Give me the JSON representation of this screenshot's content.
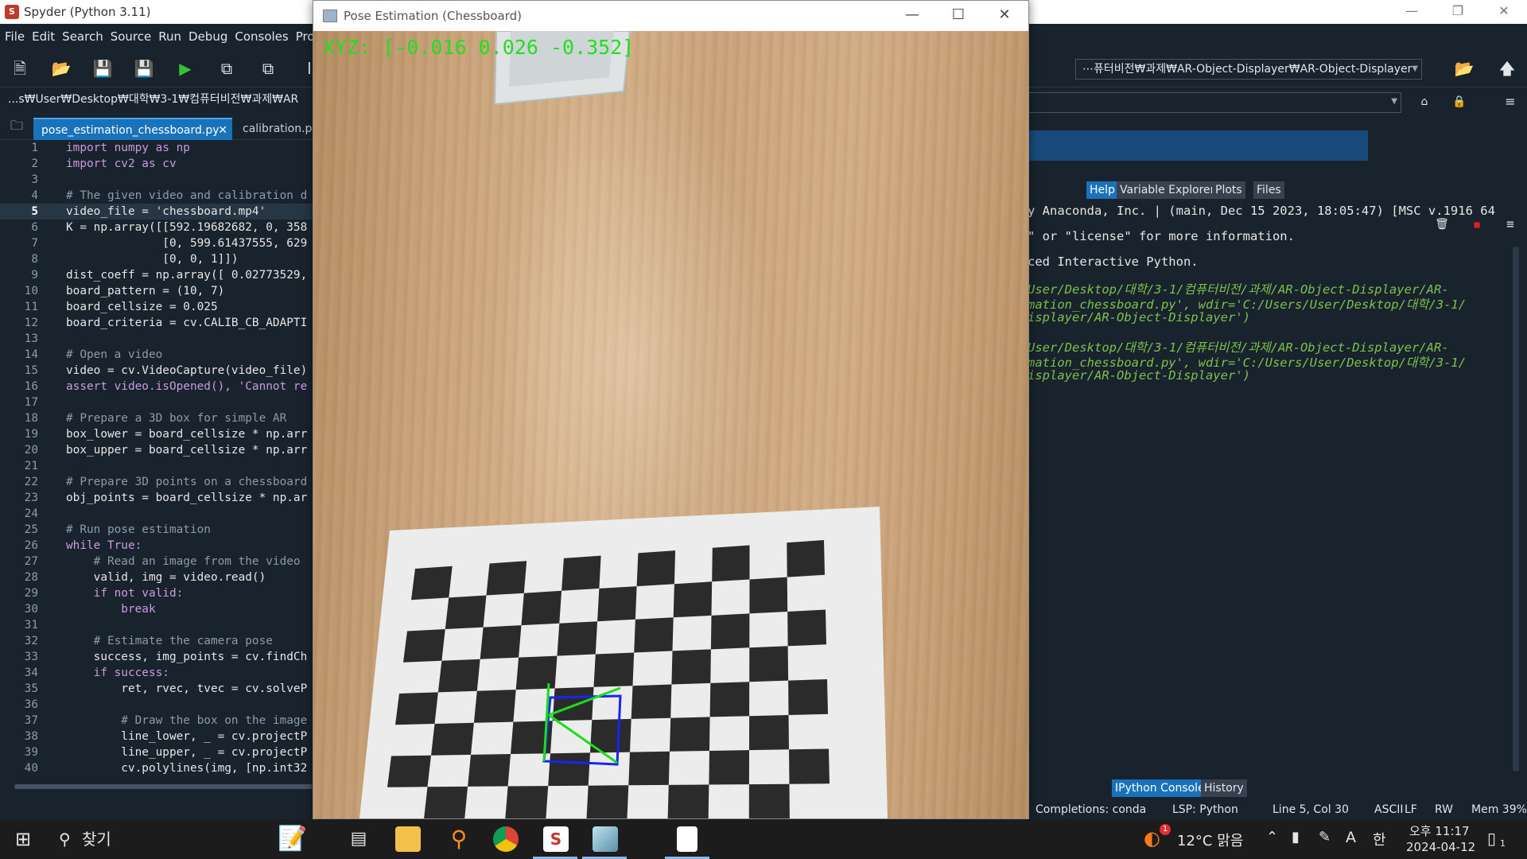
{
  "spyder": {
    "title": "Spyder (Python 3.11)",
    "menu": [
      "File",
      "Edit",
      "Search",
      "Source",
      "Run",
      "Debug",
      "Consoles",
      "Projects"
    ],
    "working_dir": "⋯퓨터비전₩과제₩AR-Object-Displayer₩AR-Object-Displayer",
    "editor_path": "...s₩User₩Desktop₩대학₩3-1₩컴퓨터비전₩과제₩AR",
    "tabs": [
      {
        "label": "pose_estimation_chessboard.py",
        "active": true
      },
      {
        "label": "calibration.py",
        "active": false
      }
    ],
    "code_lines": [
      {
        "n": "1",
        "t": "import numpy as np"
      },
      {
        "n": "2",
        "t": "import cv2 as cv"
      },
      {
        "n": "3",
        "t": ""
      },
      {
        "n": "4",
        "t": "# The given video and calibration d"
      },
      {
        "n": "5",
        "t": "video_file = 'chessboard.mp4'"
      },
      {
        "n": "6",
        "t": "K = np.array([[592.19682682, 0, 358"
      },
      {
        "n": "7",
        "t": "              [0, 599.61437555, 629"
      },
      {
        "n": "8",
        "t": "              [0, 0, 1]])"
      },
      {
        "n": "9",
        "t": "dist_coeff = np.array([ 0.02773529,"
      },
      {
        "n": "10",
        "t": "board_pattern = (10, 7)"
      },
      {
        "n": "11",
        "t": "board_cellsize = 0.025"
      },
      {
        "n": "12",
        "t": "board_criteria = cv.CALIB_CB_ADAPTI"
      },
      {
        "n": "13",
        "t": ""
      },
      {
        "n": "14",
        "t": "# Open a video"
      },
      {
        "n": "15",
        "t": "video = cv.VideoCapture(video_file)"
      },
      {
        "n": "16",
        "t": "assert video.isOpened(), 'Cannot re"
      },
      {
        "n": "17",
        "t": ""
      },
      {
        "n": "18",
        "t": "# Prepare a 3D box for simple AR"
      },
      {
        "n": "19",
        "t": "box_lower = board_cellsize * np.arr"
      },
      {
        "n": "20",
        "t": "box_upper = board_cellsize * np.arr"
      },
      {
        "n": "21",
        "t": ""
      },
      {
        "n": "22",
        "t": "# Prepare 3D points on a chessboard"
      },
      {
        "n": "23",
        "t": "obj_points = board_cellsize * np.ar"
      },
      {
        "n": "24",
        "t": ""
      },
      {
        "n": "25",
        "t": "# Run pose estimation"
      },
      {
        "n": "26",
        "t": "while True:"
      },
      {
        "n": "27",
        "t": "    # Read an image from the video"
      },
      {
        "n": "28",
        "t": "    valid, img = video.read()"
      },
      {
        "n": "29",
        "t": "    if not valid:"
      },
      {
        "n": "30",
        "t": "        break"
      },
      {
        "n": "31",
        "t": ""
      },
      {
        "n": "32",
        "t": "    # Estimate the camera pose"
      },
      {
        "n": "33",
        "t": "    success, img_points = cv.findCh"
      },
      {
        "n": "34",
        "t": "    if success:"
      },
      {
        "n": "35",
        "t": "        ret, rvec, tvec = cv.solveP"
      },
      {
        "n": "36",
        "t": ""
      },
      {
        "n": "37",
        "t": "        # Draw the box on the image"
      },
      {
        "n": "38",
        "t": "        line_lower, _ = cv.projectP"
      },
      {
        "n": "39",
        "t": "        line_upper, _ = cv.projectP"
      },
      {
        "n": "40",
        "t": "        cv.polylines(img, [np.int32"
      }
    ],
    "current_line": "5",
    "pane_tabs_top": [
      "Help",
      "Variable Explorer",
      "Plots",
      "Files"
    ],
    "console_lines": [
      {
        "t": "y Anaconda, Inc. | (main, Dec 15 2023, 18:05:47) [MSC v.1916 64",
        "g": false
      },
      {
        "t": "\" or \"license\" for more information.",
        "g": false
      },
      {
        "t": "ced Interactive Python.",
        "g": false
      },
      {
        "t": "User/Desktop/대학/3-1/컴퓨터비전/과제/AR-Object-Displayer/AR-",
        "g": true
      },
      {
        "t": "mation_chessboard.py', wdir='C:/Users/User/Desktop/대학/3-1/",
        "g": true
      },
      {
        "t": "isplayer/AR-Object-Displayer')",
        "g": true
      },
      {
        "t": "User/Desktop/대학/3-1/컴퓨터비전/과제/AR-Object-Displayer/AR-",
        "g": true
      },
      {
        "t": "mation_chessboard.py', wdir='C:/Users/User/Desktop/대학/3-1/",
        "g": true
      },
      {
        "t": "isplayer/AR-Object-Displayer')",
        "g": true
      }
    ],
    "pane_tabs_bottom": [
      "IPython Console",
      "History"
    ],
    "status": {
      "completions": "Completions: conda",
      "lsp": "LSP: Python",
      "position": "Line 5, Col 30",
      "encoding": "ASCII",
      "eol": "LF",
      "rw": "RW",
      "mem": "Mem 39%"
    }
  },
  "cv_window": {
    "title": "Pose Estimation (Chessboard)",
    "xyz_text": "XYZ: [-0.016 0.026 -0.352]"
  },
  "taskbar": {
    "search_label": "찾기",
    "weather": "12°C 맑음",
    "time": "오후 11:17",
    "date": "2024-04-12",
    "ime_a": "A",
    "ime_han": "한",
    "notification_count": "1",
    "weather_badge": "1"
  },
  "colors": {
    "spyder_bg": "#19232d",
    "tab_active": "#1a72bb",
    "console_green": "#7cc24a",
    "xyz_green": "#20e020",
    "ar_blue": "#1a24f0",
    "ar_green": "#18e018"
  }
}
